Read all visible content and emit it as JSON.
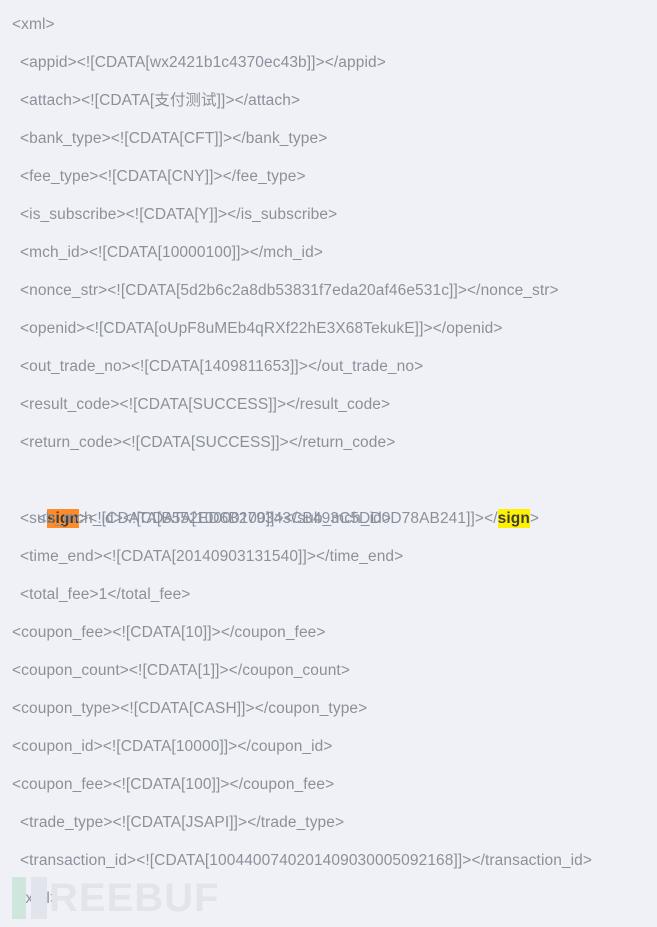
{
  "document": {
    "type": "xml",
    "language": "xml",
    "background_color": "#eff1f6",
    "text_color": "#8b909b",
    "lines": [
      {
        "id": "line-xml-open",
        "indent": "root",
        "text": "<xml>"
      },
      {
        "id": "line-appid",
        "indent": "nested",
        "text": "<appid><![CDATA[wx2421b1c4370ec43b]]></appid>"
      },
      {
        "id": "line-attach",
        "indent": "nested",
        "text": "<attach><![CDATA[支付测试]]></attach>"
      },
      {
        "id": "line-bank-type",
        "indent": "nested",
        "text": "<bank_type><![CDATA[CFT]]></bank_type>"
      },
      {
        "id": "line-fee-type",
        "indent": "nested",
        "text": "<fee_type><![CDATA[CNY]]></fee_type>"
      },
      {
        "id": "line-is-subscribe",
        "indent": "nested",
        "text": "<is_subscribe><![CDATA[Y]]></is_subscribe>"
      },
      {
        "id": "line-mch-id",
        "indent": "nested",
        "text": "<mch_id><![CDATA[10000100]]></mch_id>"
      },
      {
        "id": "line-nonce-str",
        "indent": "nested",
        "text": "<nonce_str><![CDATA[5d2b6c2a8db53831f7eda20af46e531c]]></nonce_str>"
      },
      {
        "id": "line-openid",
        "indent": "nested",
        "text": "<openid><![CDATA[oUpF8uMEb4qRXf22hE3X68TekukE]]></openid>"
      },
      {
        "id": "line-out-trade-no",
        "indent": "nested",
        "text": "<out_trade_no><![CDATA[1409811653]]></out_trade_no>"
      },
      {
        "id": "line-result-code",
        "indent": "nested",
        "text": "<result_code><![CDATA[SUCCESS]]></result_code>"
      },
      {
        "id": "line-return-code",
        "indent": "nested",
        "text": "<return_code><![CDATA[SUCCESS]]></return_code>"
      },
      {
        "id": "line-sub-mch-id",
        "indent": "nested",
        "text": "<sub_mch_id><![CDATA[10000100]]></sub_mch_id>"
      },
      {
        "id": "line-time-end",
        "indent": "nested",
        "text": "<time_end><![CDATA[20140903131540]]></time_end>"
      },
      {
        "id": "line-total-fee",
        "indent": "nested",
        "text": "<total_fee>1</total_fee>"
      },
      {
        "id": "line-coupon-fee-10",
        "indent": "root",
        "text": "<coupon_fee><![CDATA[10]]></coupon_fee>"
      },
      {
        "id": "line-coupon-count",
        "indent": "root",
        "text": "<coupon_count><![CDATA[1]]></coupon_count>"
      },
      {
        "id": "line-coupon-type",
        "indent": "root",
        "text": "<coupon_type><![CDATA[CASH]]></coupon_type>"
      },
      {
        "id": "line-coupon-id",
        "indent": "root",
        "text": "<coupon_id><![CDATA[10000]]></coupon_id>"
      },
      {
        "id": "line-coupon-fee-100",
        "indent": "root",
        "text": "<coupon_fee><![CDATA[100]]></coupon_fee>"
      },
      {
        "id": "line-trade-type",
        "indent": "nested",
        "text": "<trade_type><![CDATA[JSAPI]]></trade_type>"
      },
      {
        "id": "line-transaction-id",
        "indent": "nested",
        "text": "<transaction_id><![CDATA[1004400740201409030005092168]]></transaction_id>"
      },
      {
        "id": "line-xml-close",
        "indent": "root",
        "text": "</xml>"
      }
    ],
    "sign_line": {
      "id": "line-sign",
      "indent": "nested",
      "open_bracket": "<",
      "open_tag_name": "sign",
      "middle": "><![CDATA[B552ED6B279343CB493C5DD0D78AB241]]></",
      "close_tag_name": "sign",
      "close_bracket": ">",
      "open_highlight_color": "#ff8c28",
      "close_highlight_color": "#fff200",
      "value": "B552ED6B279343CB493C5DD0D78AB241"
    }
  },
  "watermark": {
    "text": "REEBUF",
    "full_text": "FREEBUF",
    "bar_color_primary": "#cfe6dd",
    "bar_color_secondary": "#e1e4ea",
    "text_color": "#e1e4ea"
  }
}
